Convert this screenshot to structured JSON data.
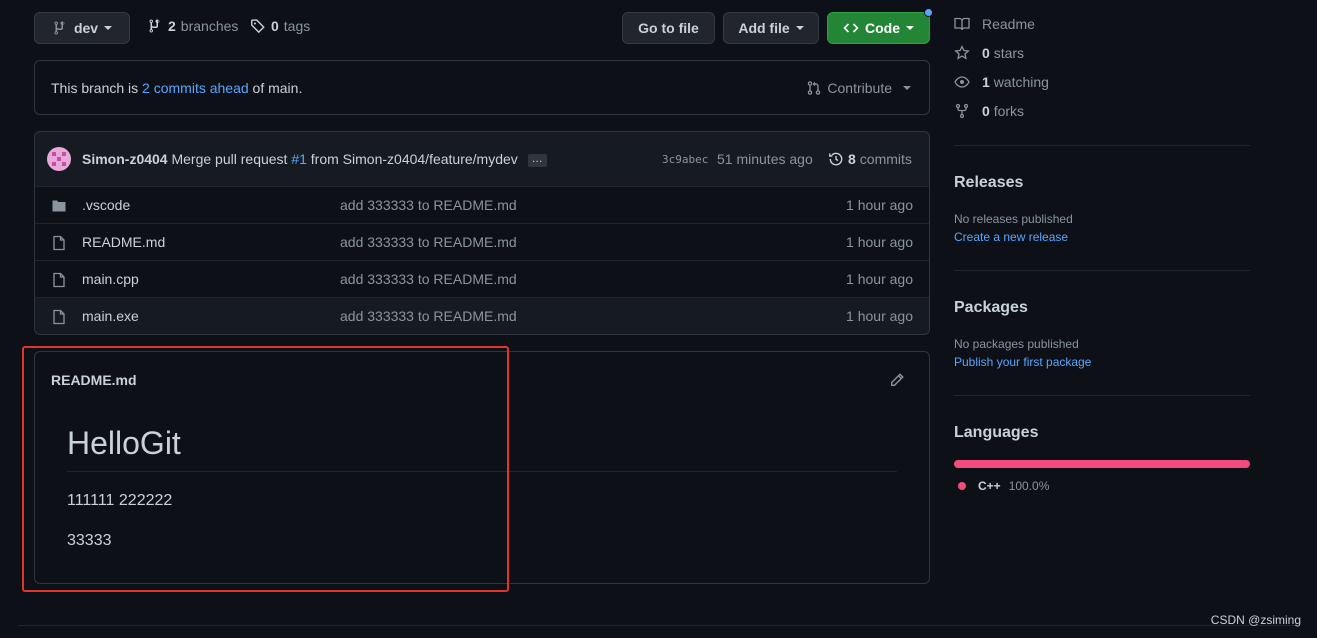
{
  "top": {
    "branch": "dev",
    "branches_count": "2",
    "branches_label": "branches",
    "tags_count": "0",
    "tags_label": "tags",
    "go_to_file": "Go to file",
    "add_file": "Add file",
    "code": "Code"
  },
  "ahead": {
    "prefix": "This branch is",
    "link": "2 commits ahead",
    "suffix": "of main.",
    "contribute": "Contribute"
  },
  "commit": {
    "author": "Simon-z0404",
    "msg1": "Merge pull request",
    "pr": "#1",
    "msg2": "from Simon-z0404/feature/mydev",
    "ellipsis": "…",
    "sha": "3c9abec",
    "time": "51 minutes ago",
    "commits_count": "8",
    "commits_label": "commits"
  },
  "files": [
    {
      "name": ".vscode",
      "type": "folder",
      "message": "add 333333 to README.md",
      "age": "1 hour ago"
    },
    {
      "name": "README.md",
      "type": "file",
      "message": "add 333333 to README.md",
      "age": "1 hour ago"
    },
    {
      "name": "main.cpp",
      "type": "file",
      "message": "add 333333 to README.md",
      "age": "1 hour ago"
    },
    {
      "name": "main.exe",
      "type": "file",
      "message": "add 333333 to README.md",
      "age": "1 hour ago"
    }
  ],
  "readme": {
    "filename": "README.md",
    "heading": "HelloGit",
    "para1": "111111 222222",
    "para2": "33333"
  },
  "sidebar": {
    "readme": "Readme",
    "stars_count": "0",
    "stars_label": "stars",
    "watching_count": "1",
    "watching_label": "watching",
    "forks_count": "0",
    "forks_label": "forks",
    "releases_title": "Releases",
    "releases_none": "No releases published",
    "releases_link": "Create a new release",
    "packages_title": "Packages",
    "packages_none": "No packages published",
    "packages_link": "Publish your first package",
    "languages_title": "Languages",
    "language_name": "C++",
    "language_pct": "100.0%",
    "language_fraction": 1.0
  },
  "watermark": "CSDN @zsiming",
  "colors": {
    "link": "#58a6ff",
    "code_button": "#238636",
    "cpp": "#f34b7d",
    "highlight_box": "#e5332a"
  }
}
